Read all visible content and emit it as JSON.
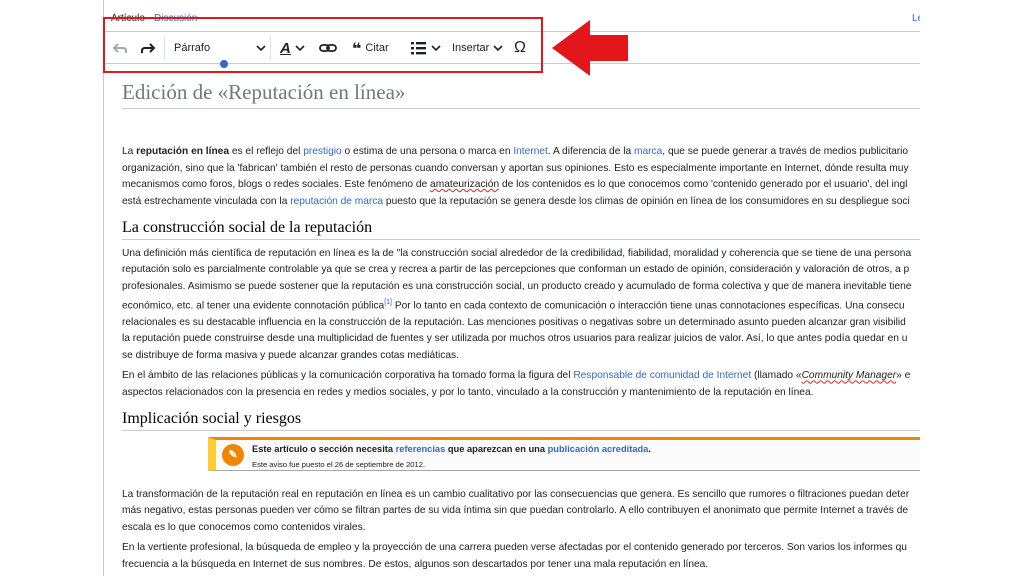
{
  "tabs": {
    "article": "Artículo",
    "discussion": "Discusión",
    "right": "Le"
  },
  "toolbar": {
    "paragraph_select": "Párrafo",
    "cite_label": "Citar",
    "insert_label": "Insertar",
    "special_char": "Ω",
    "style_glyph": "A"
  },
  "page": {
    "title": "Edición de «Reputación en línea»"
  },
  "intro": {
    "l1": [
      "La ",
      "reputación en línea",
      " es el reflejo del ",
      "prestigio",
      " o estima de una persona o marca en ",
      "Internet",
      ". A diferencia de la ",
      "marca",
      ", que se puede generar a través de medios publicitario"
    ],
    "l2": "organización, sino que la 'fabrican' también el resto de personas cuando conversan y aportan sus opiniones. Esto es especialmente importante en Internet, dónde resulta muy",
    "l3": [
      "mecanismos como foros, blogs o redes sociales. Este fenómeno de ",
      "amateurización",
      " de los contenidos es lo que conocemos como 'contenido generado por el usuario', del ingl"
    ],
    "l4": [
      "está estrechamente vinculada con la ",
      "reputación de marca",
      " puesto que la reputación se genera desde los climas de opinión en línea de los consumidores en su despliegue soci"
    ]
  },
  "section1": {
    "heading": "La construcción social de la reputación",
    "p1": [
      "Una definición más científica de reputación en línea es la de \"la construcción social alrededor de la credibilidad, fiabilidad, moralidad y coherencia que se tiene de una persona",
      "reputación solo es parcialmente controlable ya que se crea y recrea a partir de las percepciones que conforman un estado de opinión, consideración y valoración de otros, a p",
      "profesionales. Asimismo se puede sostener que la reputación es una construcción social, un producto creado y acumulado de forma colectiva y que de manera inevitable tiene",
      "económico, etc. al tener una evidente connotación pública",
      "[1]",
      "  Por lo tanto en cada contexto de comunicación o interacción tiene unas connotaciones específicas. Una consecu",
      "relacionales es su destacable influencia en la construcción de la reputación. Las menciones positivas o negativas sobre un determinado asunto pueden alcanzar gran visibilid",
      "la reputación puede construirse desde una multiplicidad de fuentes y ser utilizada por muchos otros usuarios para realizar juicios de valor. Así, lo que antes podía quedar en u",
      "se distribuye de forma masiva y puede alcanzar grandes cotas mediáticas."
    ],
    "p2a": "En el ámbito de las relaciones públicas y la comunicación corporativa ha tomado forma la figura del ",
    "p2link": "Responsable de comunidad de Internet",
    "p2b": " (llamado «",
    "p2em": "Community Manager",
    "p2c": "» e",
    "p2l2": "aspectos relacionados con la presencia en redes y medios sociales, y por lo tanto, vinculado a la construcción y mantenimiento de la reputación en línea."
  },
  "section2": {
    "heading": "Implicación social y riesgos",
    "notice": {
      "a": "Este artículo o sección necesita ",
      "link1": "referencias",
      "b": " que aparezcan en una ",
      "link2": "publicación acreditada",
      "c": ".",
      "sub": "Este aviso fue puesto el 26 de septiembre de 2012."
    },
    "p1": [
      "La transformación de la reputación real en reputación en línea es un cambio cualitativo por las consecuencias que genera. Es sencillo que rumores o filtraciones puedan deter",
      "más negativo, estas personas pueden ver cómo se filtran partes de su vida íntima sin que puedan controlarlo. A ello contribuyen el anonimato que permite Internet a través de",
      "escala es lo que conocemos como contenidos virales."
    ],
    "p2": [
      "En la vertiente profesional, la búsqueda de empleo y la proyección de una carrera pueden verse afectadas por el contenido generado por terceros. Son varios los informes qu",
      "frecuencia a la búsqueda en Internet de sus nombres. De estos, algunos son descartados por tener una mala reputación en línea."
    ]
  },
  "annotation": {
    "color": "#e3161b"
  }
}
